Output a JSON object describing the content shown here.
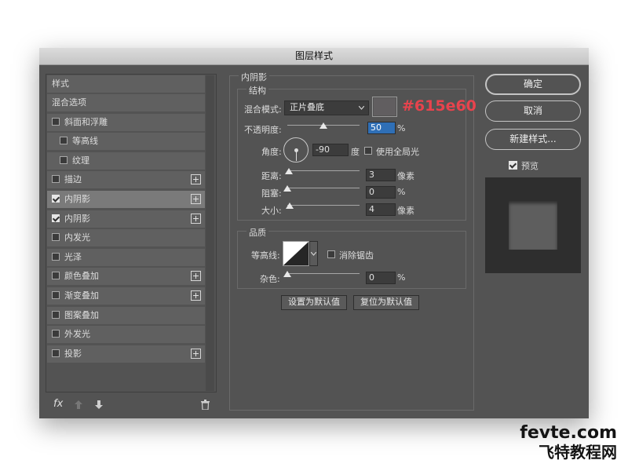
{
  "dialog": {
    "title": "图层样式"
  },
  "left": {
    "header": "样式",
    "items": [
      {
        "label": "混合选项",
        "checkbox": false,
        "checked": false,
        "plus": false,
        "indent": 0
      },
      {
        "label": "斜面和浮雕",
        "checkbox": true,
        "checked": false,
        "plus": false,
        "indent": 0
      },
      {
        "label": "等高线",
        "checkbox": true,
        "checked": false,
        "plus": false,
        "indent": 1
      },
      {
        "label": "纹理",
        "checkbox": true,
        "checked": false,
        "plus": false,
        "indent": 1
      },
      {
        "label": "描边",
        "checkbox": true,
        "checked": false,
        "plus": true,
        "indent": 0
      },
      {
        "label": "内阴影",
        "checkbox": true,
        "checked": true,
        "plus": true,
        "indent": 0,
        "selected": true
      },
      {
        "label": "内阴影",
        "checkbox": true,
        "checked": true,
        "plus": true,
        "indent": 0
      },
      {
        "label": "内发光",
        "checkbox": true,
        "checked": false,
        "plus": false,
        "indent": 0
      },
      {
        "label": "光泽",
        "checkbox": true,
        "checked": false,
        "plus": false,
        "indent": 0
      },
      {
        "label": "颜色叠加",
        "checkbox": true,
        "checked": false,
        "plus": true,
        "indent": 0
      },
      {
        "label": "渐变叠加",
        "checkbox": true,
        "checked": false,
        "plus": true,
        "indent": 0
      },
      {
        "label": "图案叠加",
        "checkbox": true,
        "checked": false,
        "plus": false,
        "indent": 0
      },
      {
        "label": "外发光",
        "checkbox": true,
        "checked": false,
        "plus": false,
        "indent": 0
      },
      {
        "label": "投影",
        "checkbox": true,
        "checked": false,
        "plus": true,
        "indent": 0
      }
    ],
    "fx": "fx",
    "fx_icons": [
      "up-arrow-icon",
      "down-arrow-icon",
      "trash-icon"
    ]
  },
  "inner_shadow": {
    "title": "内阴影",
    "structure_title": "结构",
    "blend_mode_label": "混合模式:",
    "blend_mode_value": "正片叠底",
    "color_swatch": "#615e60",
    "color_annotation": "#615e60",
    "opacity_label": "不透明度:",
    "opacity_value": "50",
    "opacity_fraction": 0.5,
    "percent": "%",
    "angle_label": "角度:",
    "angle_value": "-90",
    "angle_unit": "度",
    "global_light_label": "使用全局光",
    "distance_label": "距离:",
    "distance_value": "3",
    "distance_unit": "像素",
    "choke_label": "阻塞:",
    "choke_value": "0",
    "size_label": "大小:",
    "size_value": "4",
    "size_unit": "像素",
    "quality_title": "品质",
    "contour_label": "等高线:",
    "anti_alias_label": "消除锯齿",
    "noise_label": "杂色:",
    "noise_value": "0",
    "make_default": "设置为默认值",
    "reset_default": "复位为默认值"
  },
  "right": {
    "ok": "确定",
    "cancel": "取消",
    "new_style": "新建样式...",
    "preview_label": "预览",
    "preview_checked": true
  },
  "watermark": {
    "line1": "fevte.com",
    "line2": "飞特教程网"
  },
  "colors": {
    "annotation": "#e8434d",
    "dialog_bg": "#535353",
    "swatch": "#615e60"
  }
}
